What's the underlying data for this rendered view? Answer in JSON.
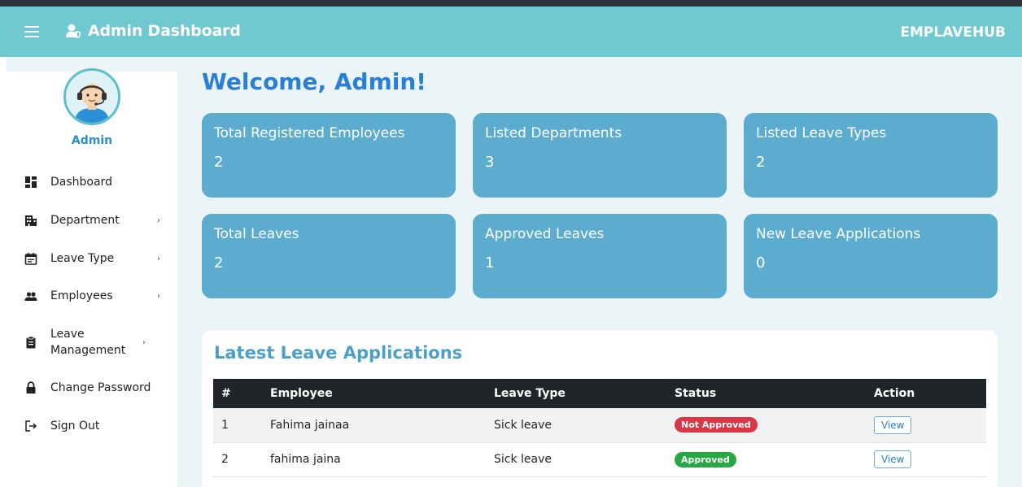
{
  "header": {
    "brand_title": "Admin Dashboard",
    "app_name": "EMPLAVEHUB",
    "brand_icon": "user-shield-icon"
  },
  "sidebar": {
    "admin_name": "Admin",
    "items": [
      {
        "label": "Dashboard",
        "icon": "dashboard-icon",
        "has_submenu": false
      },
      {
        "label": "Department",
        "icon": "building-icon",
        "has_submenu": true
      },
      {
        "label": "Leave Type",
        "icon": "calendar-icon",
        "has_submenu": true
      },
      {
        "label": "Employees",
        "icon": "users-icon",
        "has_submenu": true
      },
      {
        "label": "Leave Management",
        "icon": "clipboard-icon",
        "has_submenu": true
      },
      {
        "label": "Change Password",
        "icon": "lock-icon",
        "has_submenu": false
      },
      {
        "label": "Sign Out",
        "icon": "sign-out-icon",
        "has_submenu": false
      }
    ],
    "chevron": "›"
  },
  "main": {
    "welcome": "Welcome, Admin!",
    "cards": [
      {
        "title": "Total Registered Employees",
        "value": "2"
      },
      {
        "title": "Listed Departments",
        "value": "3"
      },
      {
        "title": "Listed Leave Types",
        "value": "2"
      },
      {
        "title": "Total Leaves",
        "value": "2"
      },
      {
        "title": "Approved Leaves",
        "value": "1"
      },
      {
        "title": "New Leave Applications",
        "value": "0"
      }
    ],
    "latest": {
      "title": "Latest Leave Applications",
      "columns": [
        "#",
        "Employee",
        "Leave Type",
        "Status",
        "Action"
      ],
      "rows": [
        {
          "num": "1",
          "employee": "Fahima jainaa",
          "leave_type": "Sick leave",
          "status": "Not Approved",
          "action": "View"
        },
        {
          "num": "2",
          "employee": "fahima jaina",
          "leave_type": "Sick leave",
          "status": "Approved",
          "action": "View"
        }
      ]
    }
  },
  "colors": {
    "header_bg": "#70c8d0",
    "card_bg": "#5cacd0",
    "main_bg": "#ebf5f8",
    "accent_blue": "#2a7fd4",
    "badge_red": "#dc3545",
    "badge_green": "#28a745"
  }
}
